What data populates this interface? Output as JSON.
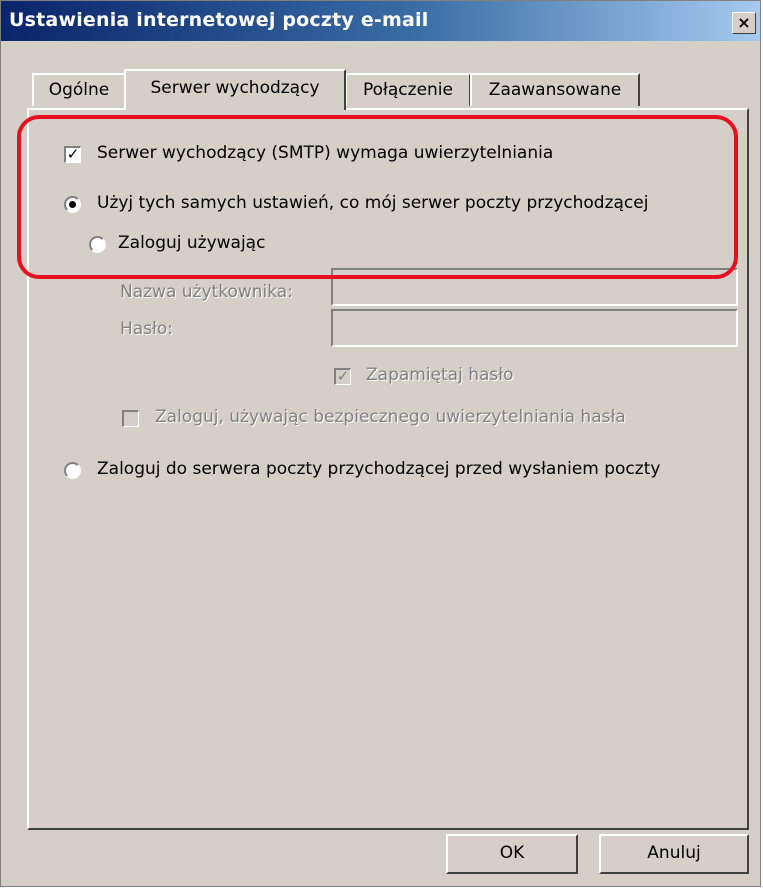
{
  "window": {
    "title": "Ustawienia internetowej poczty e-mail",
    "close_glyph": "×"
  },
  "tabs": [
    {
      "label": "Ogólne"
    },
    {
      "label": "Serwer wychodzący"
    },
    {
      "label": "Połączenie"
    },
    {
      "label": "Zaawansowane"
    }
  ],
  "active_tab": "Serwer wychodzący",
  "content": {
    "smtp_auth": {
      "label": "Serwer wychodzący (SMTP) wymaga uwierzytelniania",
      "checked": true
    },
    "radio_same": {
      "label": "Użyj tych samych ustawień, co mój serwer poczty przychodzącej",
      "checked": true
    },
    "radio_login": {
      "label": "Zaloguj używając",
      "checked": false
    },
    "username": {
      "label": "Nazwa użytkownika:",
      "value": ""
    },
    "password": {
      "label": "Hasło:",
      "value": ""
    },
    "remember": {
      "label": "Zapamiętaj hasło",
      "checked": true,
      "disabled": true
    },
    "spa": {
      "label": "Zaloguj, używając bezpiecznego uwierzytelniania hasła",
      "checked": false,
      "disabled": true
    },
    "radio_pop": {
      "label": "Zaloguj do serwera poczty przychodzącej przed wysłaniem poczty",
      "checked": false
    }
  },
  "buttons": {
    "ok": "OK",
    "cancel": "Anuluj"
  },
  "colors": {
    "titlebar_start": "#0a246a",
    "titlebar_end": "#a6caf0",
    "dialog_bg": "#d4d0c8",
    "highlight": "#e8101e"
  }
}
